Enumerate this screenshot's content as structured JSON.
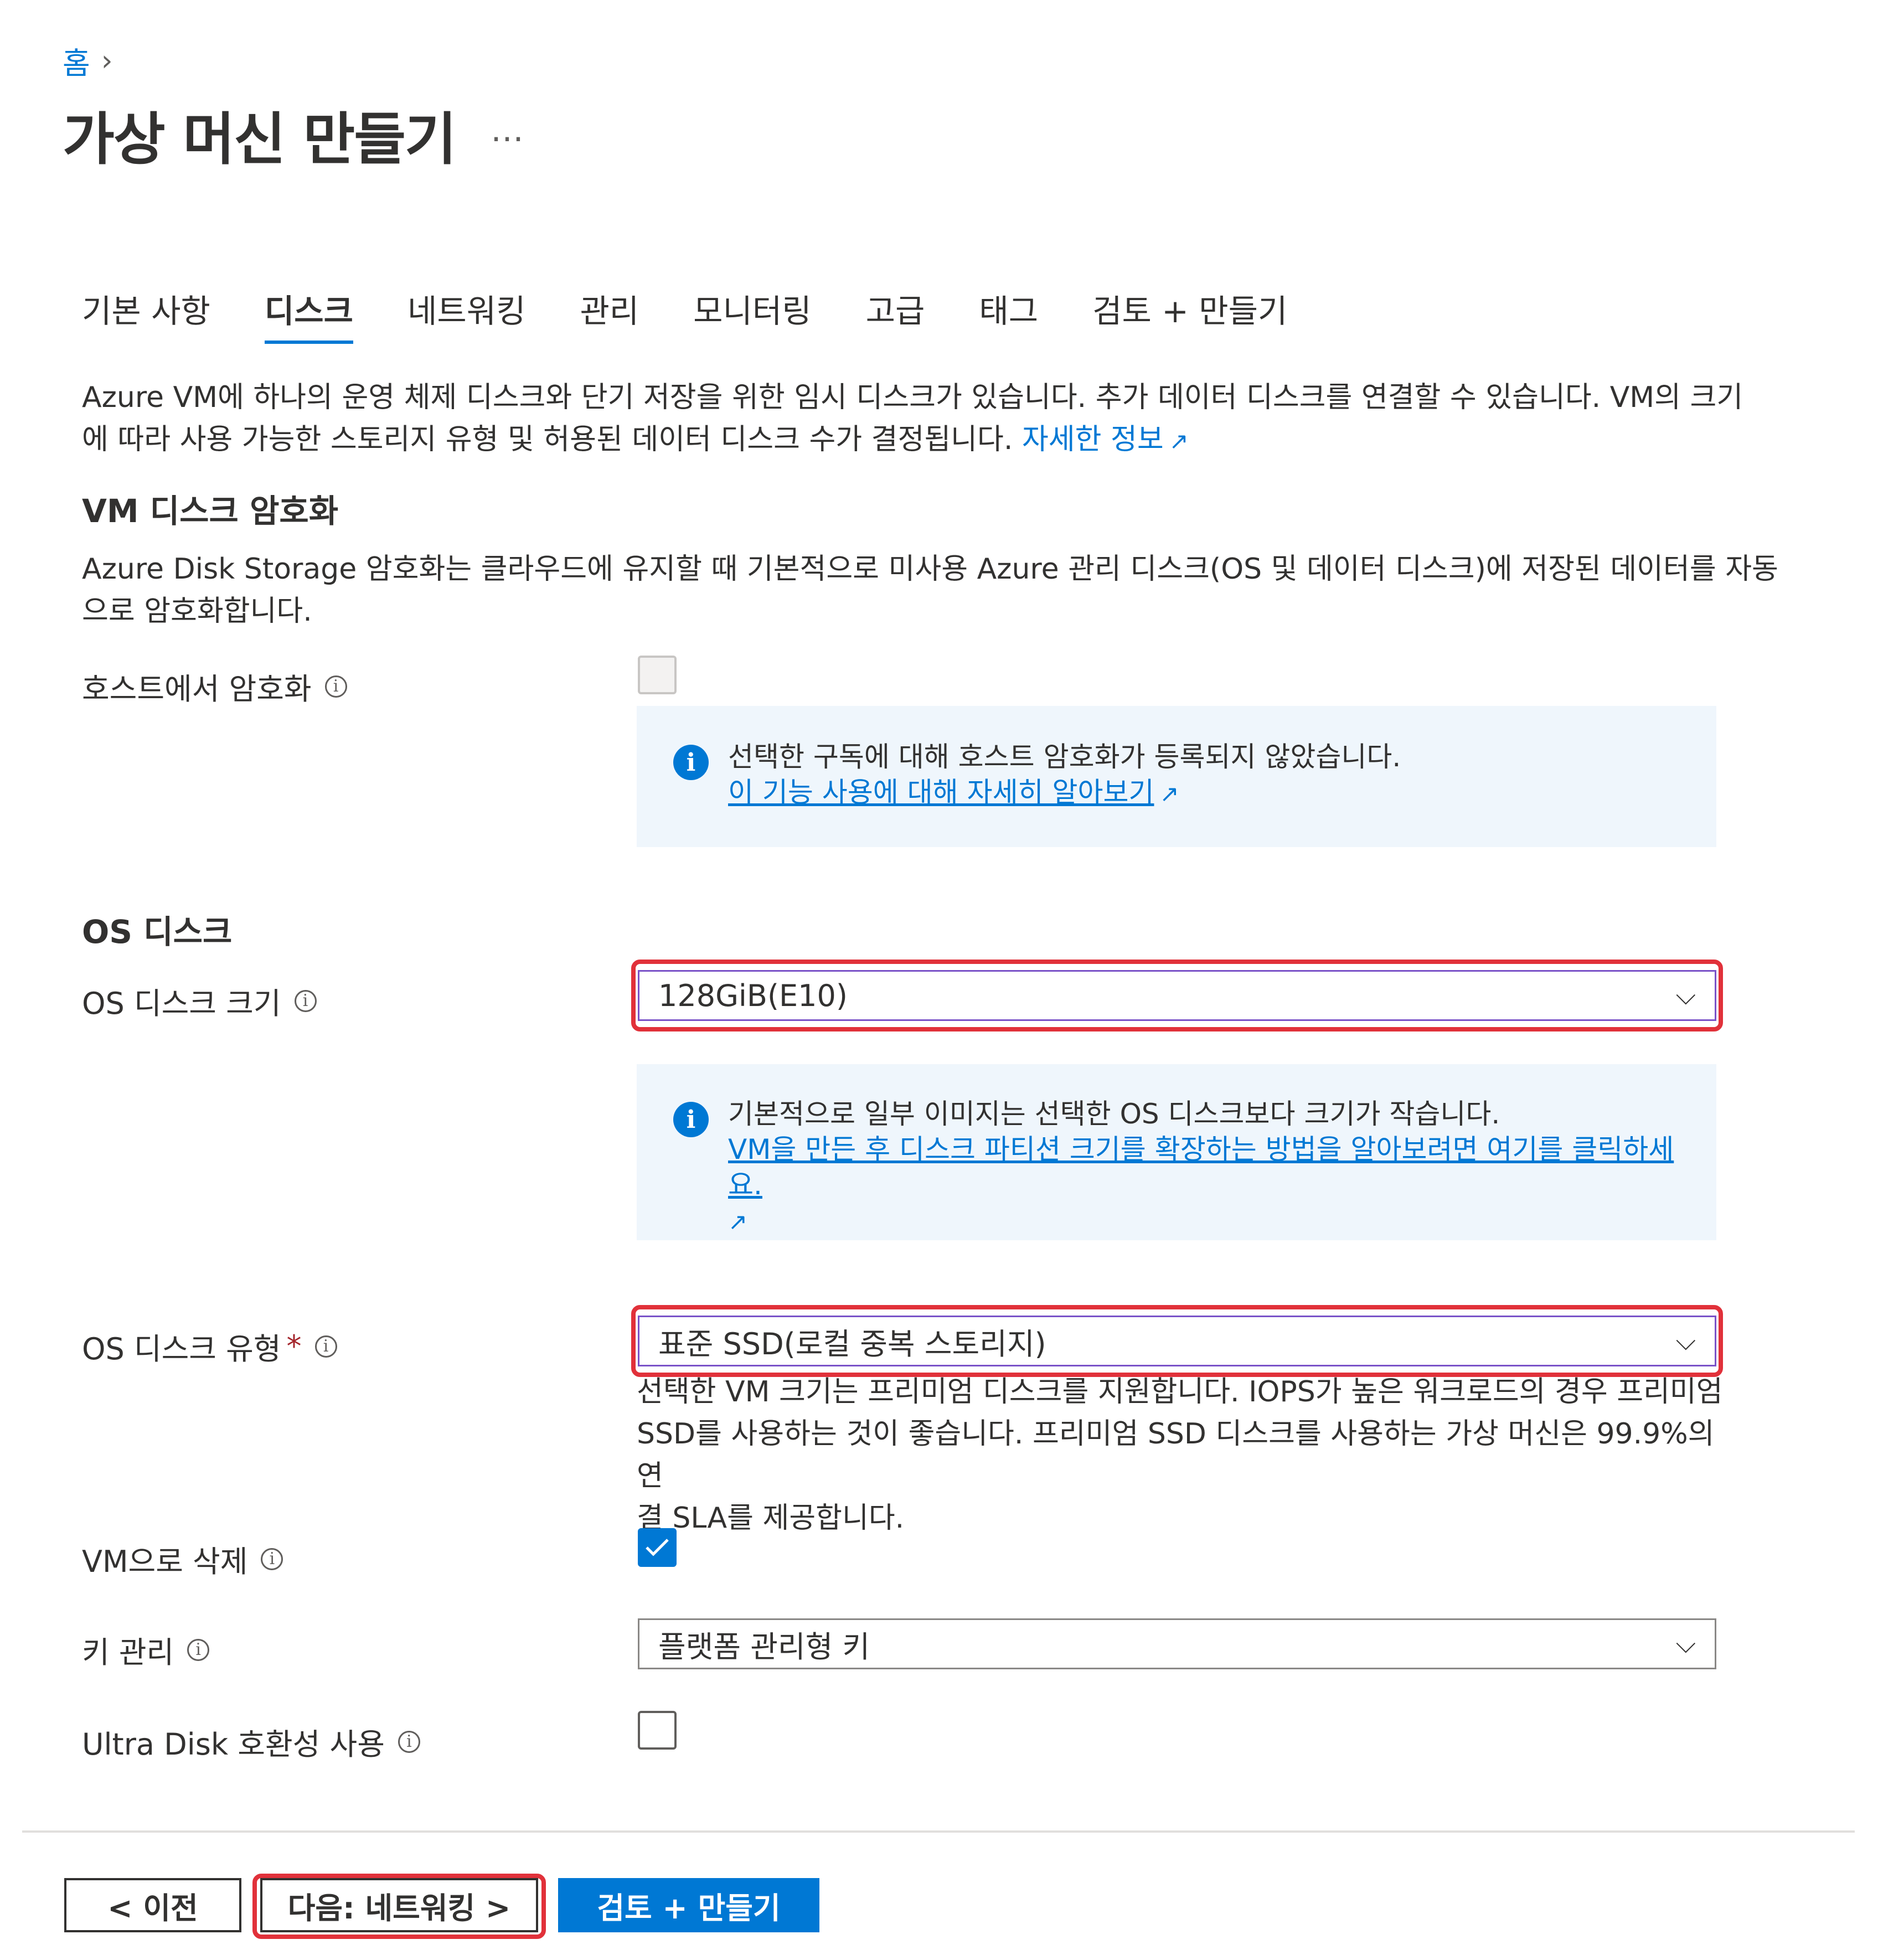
{
  "breadcrumb": {
    "home": "홈"
  },
  "page": {
    "title": "가상 머신 만들기",
    "more": "…"
  },
  "tabs": [
    {
      "label": "기본 사항"
    },
    {
      "label": "디스크"
    },
    {
      "label": "네트워킹"
    },
    {
      "label": "관리"
    },
    {
      "label": "모니터링"
    },
    {
      "label": "고급"
    },
    {
      "label": "태그"
    },
    {
      "label": "검토 + 만들기"
    }
  ],
  "active_tab": "디스크",
  "intro": {
    "line1": "Azure VM에 하나의 운영 체제 디스크와 단기 저장을 위한 임시 디스크가 있습니다. 추가 데이터 디스크를 연결할 수 있습니다. VM의 크기",
    "line2": "에 따라 사용 가능한 스토리지 유형 및 허용된 데이터 디스크 수가 결정됩니다.",
    "link": "자세한 정보"
  },
  "encryption": {
    "title": "VM 디스크 암호화",
    "desc_line1": "Azure Disk Storage 암호화는 클라우드에 유지할 때 기본적으로 미사용 Azure 관리 디스크(OS 및 데이터 디스크)에 저장된 데이터를 자동",
    "desc_line2": "으로 암호화합니다.",
    "host_label": "호스트에서 암호화",
    "host_checked": false,
    "info_text": "선택한 구독에 대해 호스트 암호화가 등록되지 않았습니다.",
    "info_link": "이 기능 사용에 대해 자세히 알아보기"
  },
  "os_disk": {
    "title": "OS 디스크",
    "size_label": "OS 디스크 크기",
    "size_value": "128GiB(E10)",
    "size_info_text": "기본적으로 일부 이미지는 선택한 OS 디스크보다 크기가 작습니다.",
    "size_info_link": "VM을 만든 후 디스크 파티션 크기를 확장하는 방법을 알아보려면 여기를 클릭하세요.",
    "type_label": "OS 디스크 유형",
    "required_mark": "*",
    "type_value": "표준 SSD(로컬 중복 스토리지)",
    "type_help_line1": "선택한 VM 크기는 프리미엄 디스크를 지원합니다. IOPS가 높은 워크로드의 경우 프리미엄",
    "type_help_line2": "SSD를 사용하는 것이 좋습니다. 프리미엄 SSD 디스크를 사용하는 가상 머신은 99.9%의 연",
    "type_help_line3": "결 SLA를 제공합니다.",
    "delete_label": "VM으로 삭제",
    "delete_checked": true,
    "key_label": "키 관리",
    "key_value": "플랫폼 관리형 키",
    "ultra_label": "Ultra Disk 호환성 사용",
    "ultra_checked": false
  },
  "footer": {
    "prev": "< 이전",
    "next": "다음: 네트워킹 >",
    "review": "검토 + 만들기"
  },
  "colors": {
    "accent": "#0078d4",
    "highlight": "#e1313a",
    "info_bg": "#eff6fc"
  }
}
